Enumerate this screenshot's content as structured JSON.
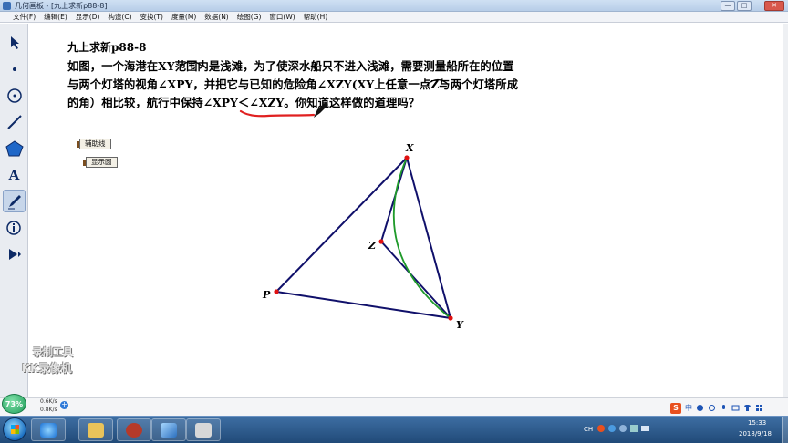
{
  "window": {
    "title": "几何画板 - [九上求新p88-8]",
    "min_glyph": "—",
    "max_glyph": "□",
    "close_glyph": "✕"
  },
  "menu": {
    "items": [
      "文件(F)",
      "编辑(E)",
      "显示(D)",
      "构造(C)",
      "变换(T)",
      "度量(M)",
      "数据(N)",
      "绘图(G)",
      "窗口(W)",
      "帮助(H)"
    ]
  },
  "toolbox": {
    "tools": [
      {
        "name": "select-arrow-tool",
        "glyph": ""
      },
      {
        "name": "point-tool",
        "glyph": ""
      },
      {
        "name": "compass-tool",
        "glyph": ""
      },
      {
        "name": "straightedge-tool",
        "glyph": ""
      },
      {
        "name": "polygon-tool",
        "glyph": ""
      },
      {
        "name": "text-tool",
        "glyph": "A"
      },
      {
        "name": "marker-tool",
        "glyph": ""
      },
      {
        "name": "information-tool",
        "glyph": ""
      },
      {
        "name": "custom-tool",
        "glyph": ""
      }
    ],
    "active_index": 6
  },
  "problem": {
    "title": "九上求新p88-8",
    "line1": "如图，一个海港在XY范围内是浅滩，为了使深水船只不进入浅滩，需要测量船所在的位置",
    "line2": "与两个灯塔的视角∠XPY，并把它与已知的危险角∠XZY(XY上任意一点Z与两个灯塔所成",
    "line3": "的角）相比较，航行中保持∠XPY＜∠XZY。你知道这样做的道理吗？"
  },
  "buttons": {
    "aux_line": "辅助线",
    "show_circle": "显示圆"
  },
  "figure": {
    "labels": {
      "X": "X",
      "Y": "Y",
      "Z": "Z",
      "P": "P"
    },
    "line_color": "#10106a",
    "arc_color": "#1f9a2a",
    "point_color": "#e01010",
    "annotation_color": "#e02020"
  },
  "watermark": {
    "line1": "录制工具",
    "line2": "KK录像机"
  },
  "status": {
    "cpu_percent": "73%",
    "upload": "0.6K/s",
    "download": "0.8K/s",
    "plus": "+"
  },
  "tray": {
    "ime_logo": "S",
    "ime_label": "中",
    "lang": "CH",
    "time": "15:33",
    "date": "2018/9/18"
  },
  "taskbar": {
    "apps": [
      {
        "name": "ie-browser",
        "color": "#2a8ee8"
      },
      {
        "name": "file-explorer",
        "color": "#e9c35a"
      },
      {
        "name": "recorder-app",
        "color": "#b53a2a"
      },
      {
        "name": "sketchpad-app",
        "color": "#5aa0e0"
      },
      {
        "name": "media-app",
        "color": "#d8d8d8"
      }
    ]
  }
}
